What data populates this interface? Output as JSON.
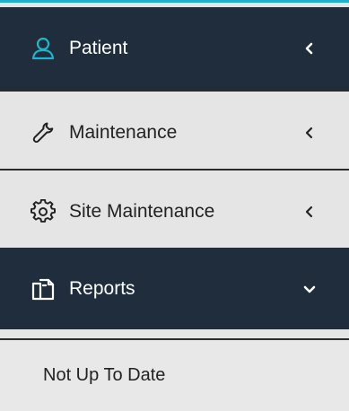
{
  "colors": {
    "accent": "#19b3cc",
    "dark_bg": "#1f2d3d",
    "light_bg": "#e5e5e5"
  },
  "menu": {
    "items": [
      {
        "label": "Patient",
        "icon": "user-icon",
        "state": "collapsed"
      },
      {
        "label": "Maintenance",
        "icon": "wrench-icon",
        "state": "collapsed"
      },
      {
        "label": "Site Maintenance",
        "icon": "gear-icon",
        "state": "collapsed"
      },
      {
        "label": "Reports",
        "icon": "reports-icon",
        "state": "expanded"
      }
    ],
    "reports_subitems": [
      {
        "label": "Not Up To Date"
      }
    ]
  }
}
